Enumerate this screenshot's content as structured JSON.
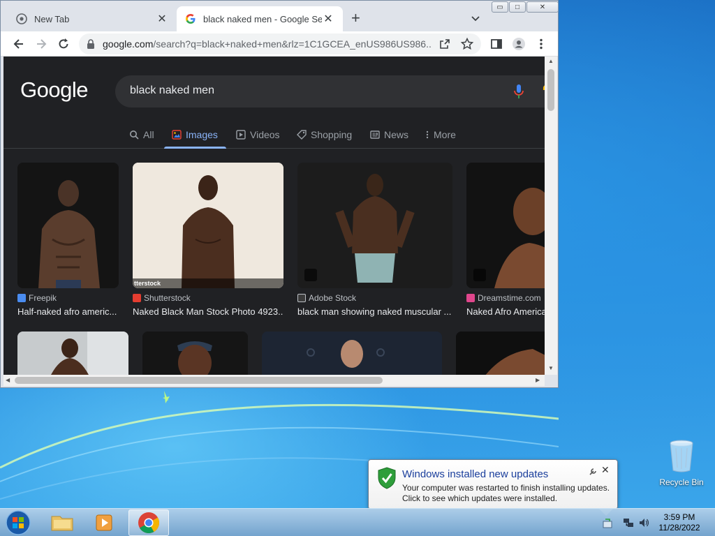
{
  "browser": {
    "tabs": [
      {
        "title": "New Tab",
        "active": false
      },
      {
        "title": "black naked men - Google Search",
        "active": true
      }
    ],
    "window_controls": {
      "minimize": "▭",
      "maximize": "□",
      "close": "✕"
    },
    "tab_close_glyph": "✕",
    "new_tab_glyph": "+",
    "url": {
      "host": "google.com",
      "path": "/search?q=black+naked+men&rlz=1C1GCEA_enUS986US986..."
    }
  },
  "google": {
    "logo": "Google",
    "query": "black naked men",
    "nav": [
      {
        "label": "All",
        "icon": "search-icon"
      },
      {
        "label": "Images",
        "icon": "image-icon",
        "active": true
      },
      {
        "label": "Videos",
        "icon": "video-icon"
      },
      {
        "label": "Shopping",
        "icon": "tag-icon"
      },
      {
        "label": "News",
        "icon": "news-icon"
      },
      {
        "label": "More",
        "icon": "more-vert-icon"
      }
    ],
    "results": [
      {
        "source": "Freepik",
        "title": "Half-naked afro americ...",
        "source_color": "#4a8cf0"
      },
      {
        "source": "Shutterstock",
        "title": "Naked Black Man Stock Photo 4923...",
        "source_color": "#e43d30",
        "overlay": "tterstock"
      },
      {
        "source": "Adobe Stock",
        "title": "black man showing naked muscular ...",
        "source_color": "#3b3b3b"
      },
      {
        "source": "Dreamstime.com",
        "title": "Naked Afro America",
        "source_color": "#e0468c"
      }
    ]
  },
  "notification": {
    "title": "Windows installed new updates",
    "line1": "Your computer was restarted to finish installing updates.",
    "line2": "Click to see which updates were installed.",
    "close_glyph": "✕"
  },
  "desktop": {
    "recycle_bin": "Recycle Bin"
  },
  "taskbar": {
    "time": "3:59 PM",
    "date": "11/28/2022"
  }
}
